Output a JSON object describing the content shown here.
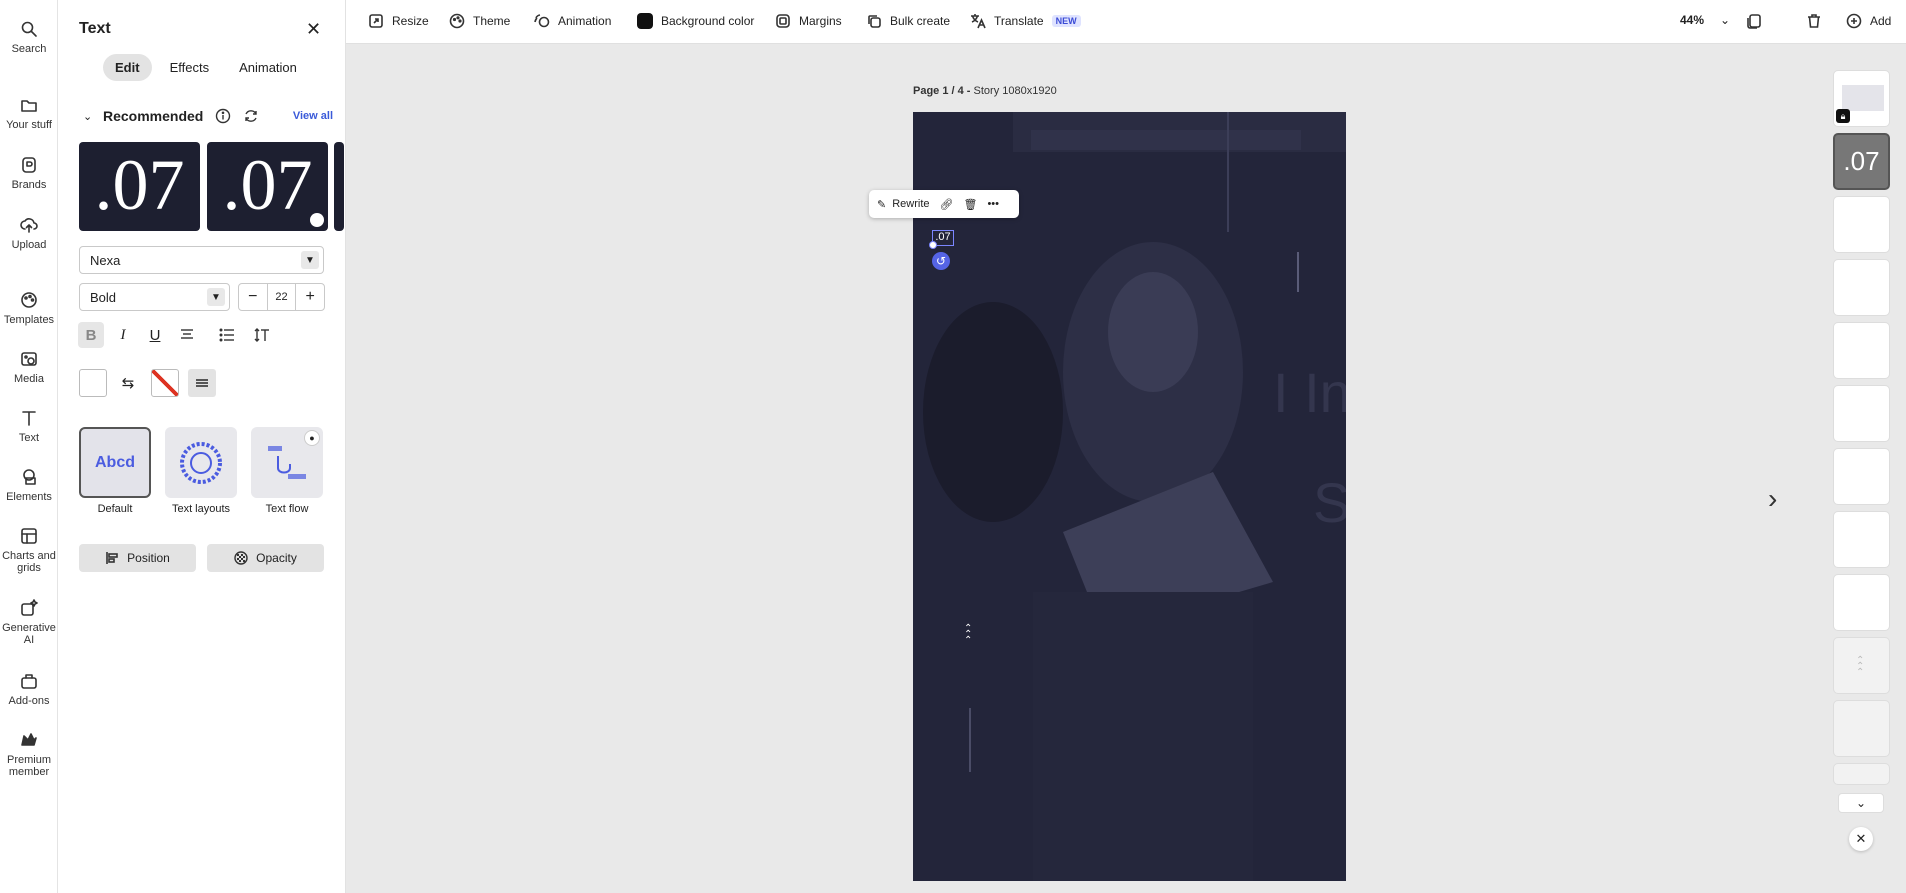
{
  "rail": [
    {
      "label": "Search",
      "icon": "search-icon"
    },
    {
      "label": "Your stuff",
      "icon": "folder-icon"
    },
    {
      "label": "Brands",
      "icon": "brand-icon"
    },
    {
      "label": "Upload",
      "icon": "upload-icon"
    },
    {
      "label": "Templates",
      "icon": "templates-icon"
    },
    {
      "label": "Media",
      "icon": "media-icon"
    },
    {
      "label": "Text",
      "icon": "text-icon"
    },
    {
      "label": "Elements",
      "icon": "elements-icon"
    },
    {
      "label": "Charts and grids",
      "icon": "charts-icon"
    },
    {
      "label": "Generative AI",
      "icon": "sparkle-icon"
    },
    {
      "label": "Add-ons",
      "icon": "addons-icon"
    },
    {
      "label": "Premium member",
      "icon": "crown-icon"
    }
  ],
  "panel": {
    "title": "Text",
    "close": "✕",
    "tabs": [
      "Edit",
      "Effects",
      "Animation"
    ],
    "recommended": "Recommended",
    "view_all": "View all",
    "preset_text": ".07",
    "font": "Nexa",
    "weight": "Bold",
    "size": "22",
    "minus": "−",
    "plus": "+",
    "fmt_bold": "B",
    "fmt_italic": "I",
    "fmt_underline": "U",
    "styles": [
      "Default",
      "Text layouts",
      "Text flow"
    ],
    "default_sample": "Abcd",
    "position": "Position",
    "opacity": "Opacity"
  },
  "toolbar": {
    "resize": "Resize",
    "theme": "Theme",
    "animation": "Animation",
    "background_color": "Background color",
    "margins": "Margins",
    "bulk_create": "Bulk create",
    "translate": "Translate",
    "new_badge": "NEW",
    "zoom": "44%",
    "add": "Add"
  },
  "canvas": {
    "page_prefix": "Page 1 / 4 -",
    "page_size": " Story 1080x1920",
    "rewrite": "Rewrite",
    "selected_text": ".07"
  },
  "thumbs": {
    "active_text": ".07"
  },
  "colors": {
    "artboard": "#23253a",
    "accent": "#3a5ad9"
  }
}
